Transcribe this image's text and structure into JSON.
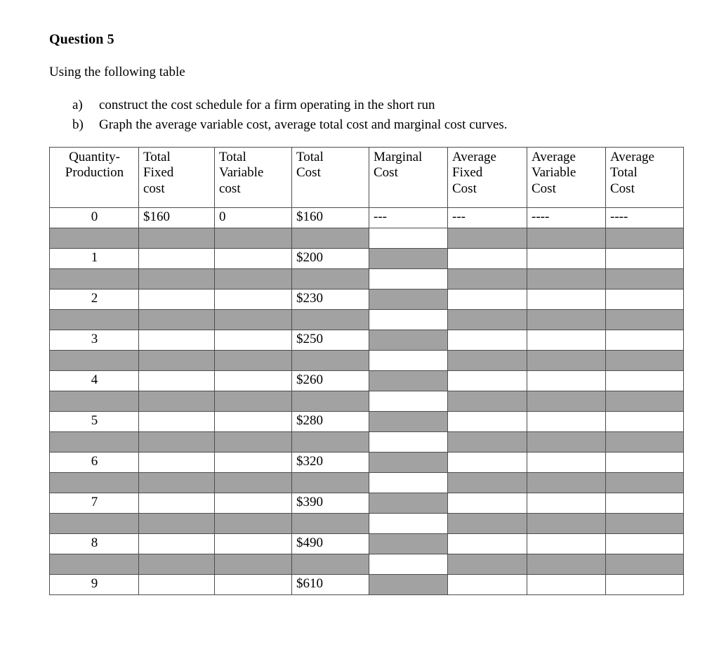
{
  "document": {
    "question_title": "Question 5",
    "intro": "Using the following table",
    "tasks": [
      {
        "marker": "a)",
        "text": "construct the cost schedule for a firm operating in the short run"
      },
      {
        "marker": "b)",
        "text": "Graph the average variable cost, average total cost and marginal cost curves."
      }
    ]
  },
  "table": {
    "headers": [
      {
        "id": "quantity",
        "lines": [
          "Quantity-",
          "Production"
        ]
      },
      {
        "id": "total_fixed_cost",
        "lines": [
          "Total",
          "Fixed",
          "cost"
        ]
      },
      {
        "id": "total_variable_cost",
        "lines": [
          "Total",
          "Variable",
          "cost"
        ]
      },
      {
        "id": "total_cost",
        "lines": [
          "Total",
          "Cost"
        ]
      },
      {
        "id": "marginal_cost",
        "lines": [
          "Marginal",
          "Cost"
        ]
      },
      {
        "id": "average_fixed_cost",
        "lines": [
          "Average",
          "Fixed",
          "Cost"
        ]
      },
      {
        "id": "average_variable_cost",
        "lines": [
          "Average",
          "Variable",
          "Cost"
        ]
      },
      {
        "id": "average_total_cost",
        "lines": [
          "Average",
          "Total",
          "Cost"
        ]
      }
    ],
    "rows": [
      {
        "quantity": "0",
        "total_fixed_cost": "$160",
        "total_variable_cost": "0",
        "total_cost": "$160",
        "marginal_cost": "---",
        "average_fixed_cost": "---",
        "average_variable_cost": "----",
        "average_total_cost": "----"
      },
      {
        "quantity": "1",
        "total_fixed_cost": "",
        "total_variable_cost": "",
        "total_cost": "$200",
        "marginal_cost": "",
        "average_fixed_cost": "",
        "average_variable_cost": "",
        "average_total_cost": ""
      },
      {
        "quantity": "2",
        "total_fixed_cost": "",
        "total_variable_cost": "",
        "total_cost": "$230",
        "marginal_cost": "",
        "average_fixed_cost": "",
        "average_variable_cost": "",
        "average_total_cost": ""
      },
      {
        "quantity": "3",
        "total_fixed_cost": "",
        "total_variable_cost": "",
        "total_cost": "$250",
        "marginal_cost": "",
        "average_fixed_cost": "",
        "average_variable_cost": "",
        "average_total_cost": ""
      },
      {
        "quantity": "4",
        "total_fixed_cost": "",
        "total_variable_cost": "",
        "total_cost": "$260",
        "marginal_cost": "",
        "average_fixed_cost": "",
        "average_variable_cost": "",
        "average_total_cost": ""
      },
      {
        "quantity": "5",
        "total_fixed_cost": "",
        "total_variable_cost": "",
        "total_cost": "$280",
        "marginal_cost": "",
        "average_fixed_cost": "",
        "average_variable_cost": "",
        "average_total_cost": ""
      },
      {
        "quantity": "6",
        "total_fixed_cost": "",
        "total_variable_cost": "",
        "total_cost": "$320",
        "marginal_cost": "",
        "average_fixed_cost": "",
        "average_variable_cost": "",
        "average_total_cost": ""
      },
      {
        "quantity": "7",
        "total_fixed_cost": "",
        "total_variable_cost": "",
        "total_cost": "$390",
        "marginal_cost": "",
        "average_fixed_cost": "",
        "average_variable_cost": "",
        "average_total_cost": ""
      },
      {
        "quantity": "8",
        "total_fixed_cost": "",
        "total_variable_cost": "",
        "total_cost": "$490",
        "marginal_cost": "",
        "average_fixed_cost": "",
        "average_variable_cost": "",
        "average_total_cost": ""
      },
      {
        "quantity": "9",
        "total_fixed_cost": "",
        "total_variable_cost": "",
        "total_cost": "$610",
        "marginal_cost": "",
        "average_fixed_cost": "",
        "average_variable_cost": "",
        "average_total_cost": ""
      }
    ],
    "shading": {
      "shade_color": "#a2a2a2",
      "plain_color": "#ffffff",
      "border_color": "#4d4d4d",
      "note": "Data rows: all cells white except Marginal Cost which is shaded (except row 0 where Marginal Cost is white and holds ---). Spacer rows between data rows: all cells shaded except Marginal Cost which is white."
    }
  }
}
